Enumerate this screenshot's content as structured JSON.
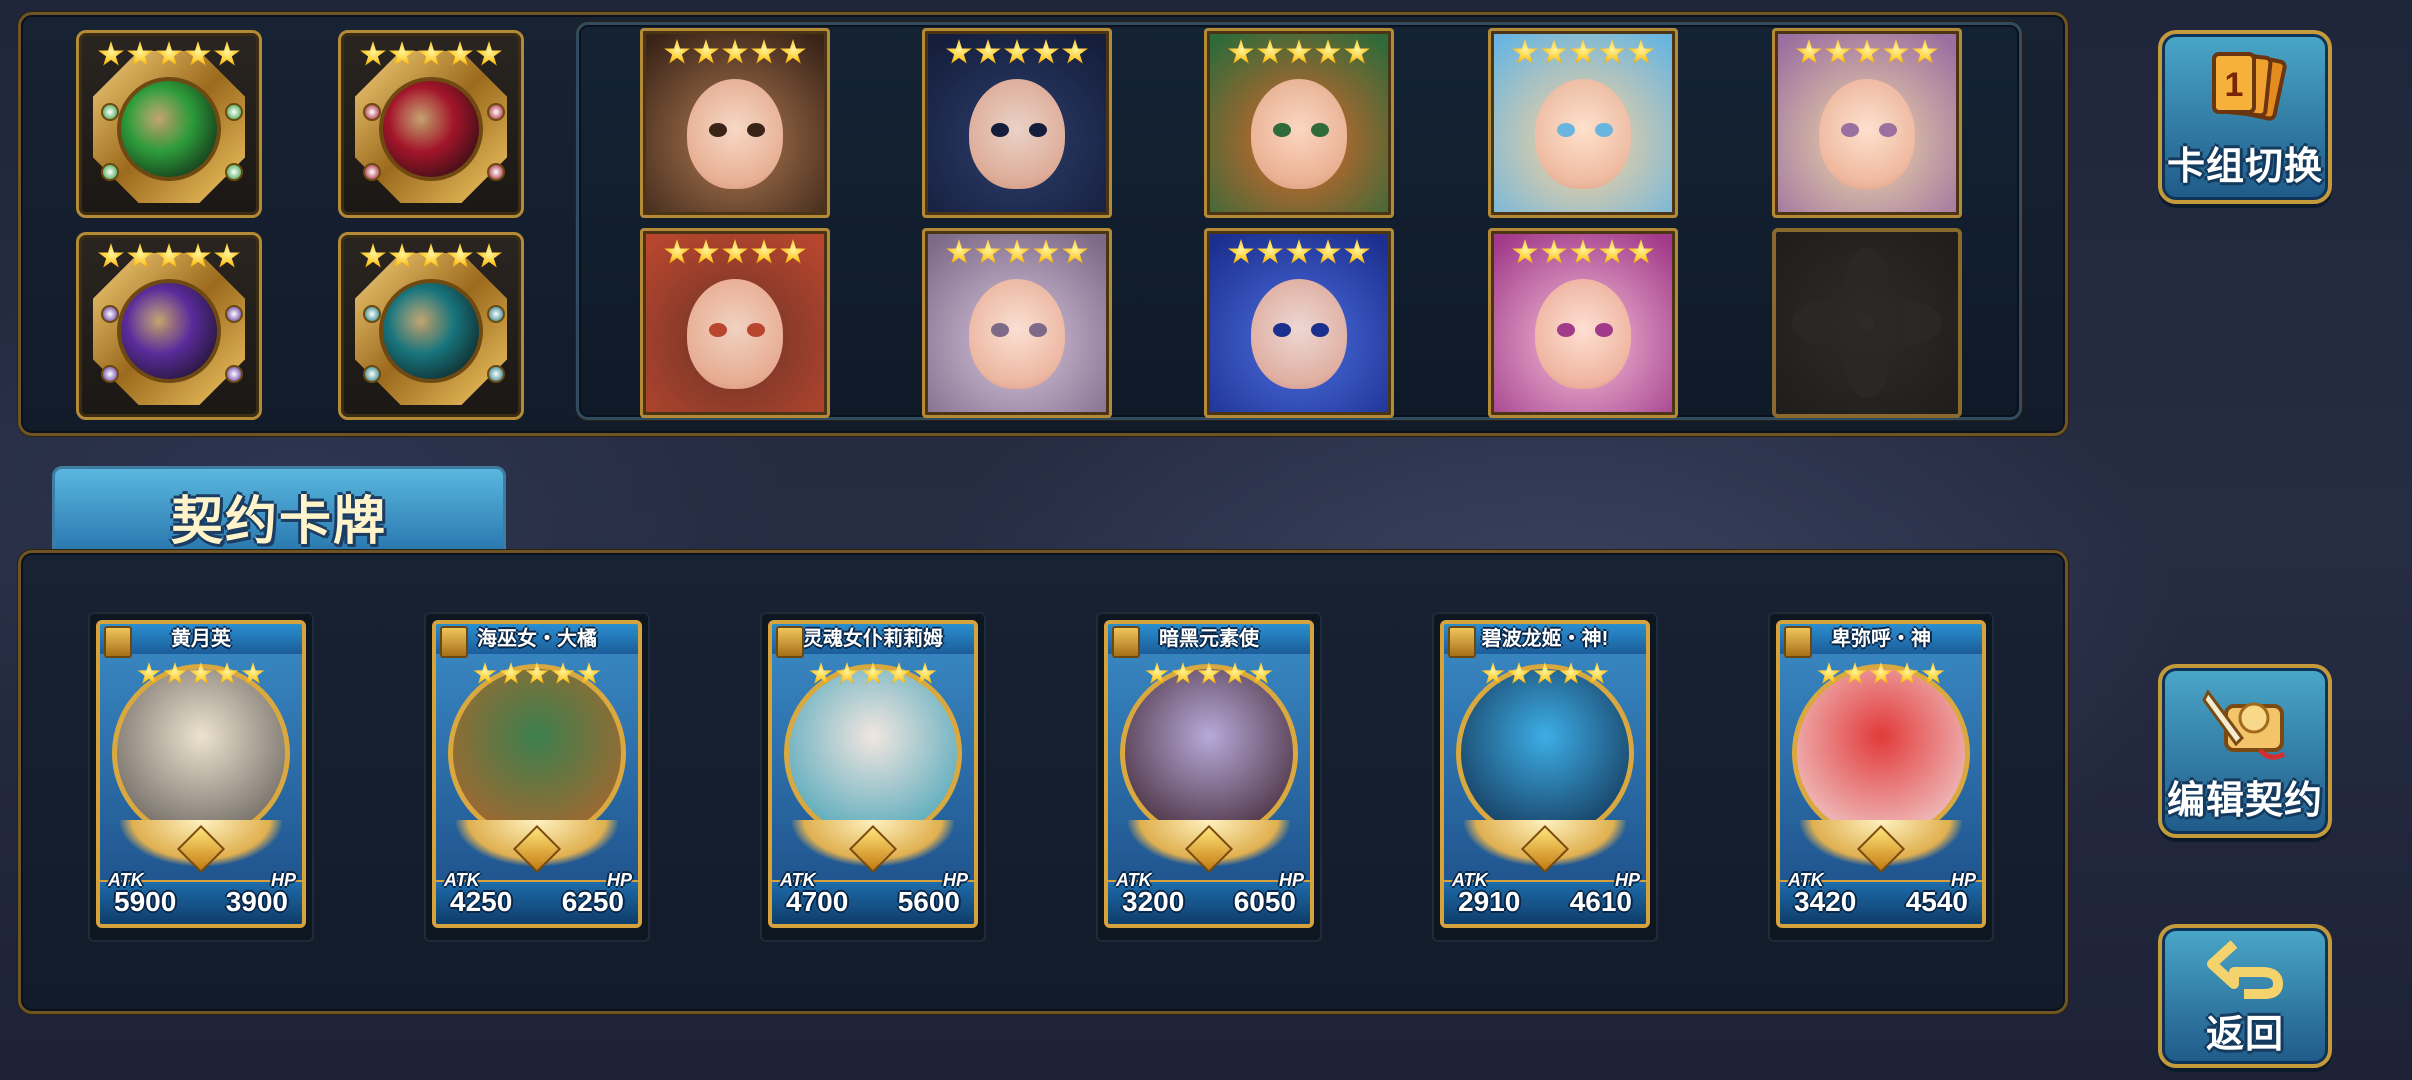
{
  "colors": {
    "gold": "#d6a23b",
    "panel": "#121b29",
    "button_blue": "#2a79b0"
  },
  "emblems": [
    {
      "name": "green-pentagram-emblem",
      "color": "#2c9b3a",
      "stars": 5
    },
    {
      "name": "red-dragon-emblem",
      "color": "#a3152a",
      "stars": 5
    },
    {
      "name": "purple-vortex-emblem",
      "color": "#5a2c9b",
      "stars": 5
    },
    {
      "name": "teal-urchin-emblem",
      "color": "#18757d",
      "stars": 5
    }
  ],
  "portraits": [
    {
      "name": "portrait-brown-hair-girl",
      "colors": [
        "#b07a52",
        "#3a2418"
      ],
      "stars": 5
    },
    {
      "name": "portrait-dark-teal-hair-girl",
      "colors": [
        "#2d3f6e",
        "#141d3a"
      ],
      "stars": 5
    },
    {
      "name": "portrait-red-curly-hair-girl",
      "colors": [
        "#e0662a",
        "#2f6a3a"
      ],
      "stars": 5
    },
    {
      "name": "portrait-lucky-cat",
      "colors": [
        "#ffd39a",
        "#6ab5e0"
      ],
      "stars": 5
    },
    {
      "name": "portrait-blonde-girl",
      "colors": [
        "#f0d7a8",
        "#9b6fa0"
      ],
      "stars": 5
    },
    {
      "name": "portrait-dark-hair-red-girl",
      "colors": [
        "#6b3328",
        "#b8462e"
      ],
      "stars": 5
    },
    {
      "name": "portrait-white-hair-girl",
      "colors": [
        "#d8c4dc",
        "#7c6a88"
      ],
      "stars": 5
    },
    {
      "name": "portrait-blue-ghost-girl",
      "colors": [
        "#4d6fe0",
        "#1b2f8f"
      ],
      "stars": 5
    },
    {
      "name": "portrait-blonde-laughing-girl",
      "colors": [
        "#f6c1d8",
        "#a13a8a"
      ],
      "stars": 5
    }
  ],
  "section_tab": {
    "label": "契约卡牌"
  },
  "cards": [
    {
      "name": "黄月英",
      "atk_label": "ATK",
      "hp_label": "HP",
      "atk": "5900",
      "hp": "3900",
      "stars": 5,
      "art": [
        "#ece3cf",
        "#5d5754"
      ]
    },
    {
      "name": "海巫女・大橘",
      "atk_label": "ATK",
      "hp_label": "HP",
      "atk": "4250",
      "hp": "6250",
      "stars": 5,
      "art": [
        "#3b7f4e",
        "#b5642a"
      ]
    },
    {
      "name": "灵魂女仆莉莉姆",
      "atk_label": "ATK",
      "hp_label": "HP",
      "atk": "4700",
      "hp": "5600",
      "stars": 5,
      "art": [
        "#f1e6e0",
        "#3da0b6"
      ]
    },
    {
      "name": "暗黑元素使",
      "atk_label": "ATK",
      "hp_label": "HP",
      "atk": "3200",
      "hp": "6050",
      "stars": 5,
      "art": [
        "#b7a9d9",
        "#3a1f2a"
      ]
    },
    {
      "name": "碧波龙姬・神!",
      "atk_label": "ATK",
      "hp_label": "HP",
      "atk": "2910",
      "hp": "4610",
      "stars": 5,
      "art": [
        "#3daee6",
        "#102a4a"
      ]
    },
    {
      "name": "卑弥呼・神",
      "atk_label": "ATK",
      "hp_label": "HP",
      "atk": "3420",
      "hp": "4540",
      "stars": 5,
      "art": [
        "#e23a3a",
        "#f2d8d8"
      ]
    }
  ],
  "buttons": {
    "deck_switch": {
      "label": "卡组切换",
      "icon": "cards-icon"
    },
    "edit_contract": {
      "label": "编辑契约",
      "icon": "scroll-quill-icon"
    },
    "back": {
      "label": "返回",
      "icon": "return-arrow-icon"
    }
  }
}
